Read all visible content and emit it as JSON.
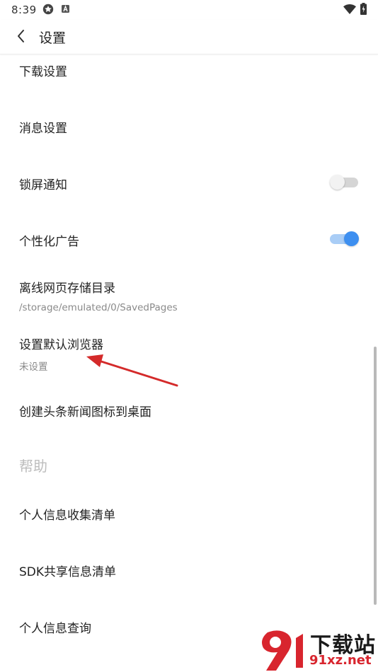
{
  "status_bar": {
    "time": "8:39",
    "icons": [
      "sync-icon",
      "a-badge-icon",
      "wifi-icon",
      "battery-charging-icon"
    ]
  },
  "header": {
    "back_icon": "chevron-left-icon",
    "title": "设置"
  },
  "settings": {
    "download": {
      "label": "下载设置"
    },
    "messages": {
      "label": "消息设置"
    },
    "lock_screen": {
      "label": "锁屏通知",
      "enabled": false
    },
    "personalized_ads": {
      "label": "个性化广告",
      "enabled": true
    },
    "offline_dir": {
      "label": "离线网页存储目录",
      "value": "/storage/emulated/0/SavedPages"
    },
    "default_browser": {
      "label": "设置默认浏览器",
      "value": "未设置"
    },
    "desktop_icon": {
      "label": "创建头条新闻图标到桌面"
    }
  },
  "help": {
    "header": "帮助",
    "personal_info_list": {
      "label": "个人信息收集清单"
    },
    "sdk_list": {
      "label": "SDK共享信息清单"
    },
    "personal_info_query": {
      "label": "个人信息查询"
    }
  },
  "watermark": {
    "text": "下载站",
    "url": "91xz.net"
  },
  "colors": {
    "toggle_on": "#3d8ff0",
    "toggle_on_track": "#a9cdf6",
    "toggle_off_track": "#d5d5d5",
    "annotation_arrow": "#d42a2a",
    "watermark_red": "#d8252e"
  }
}
